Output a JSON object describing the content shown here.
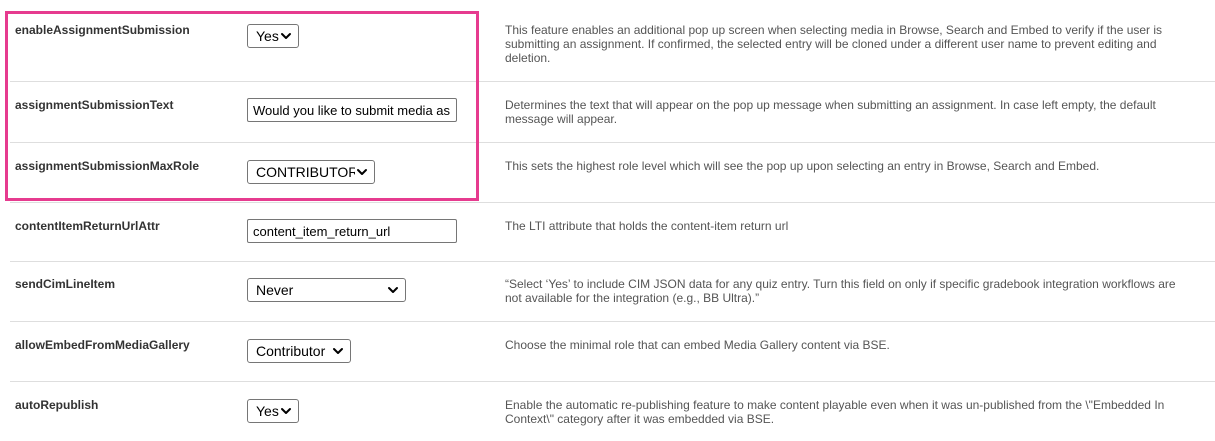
{
  "colors": {
    "highlight": "#e63b8f",
    "divider": "#dedede",
    "label_text": "#333333",
    "description_text": "#555555"
  },
  "settings": [
    {
      "key": "enableAssignmentSubmission",
      "control": "select",
      "value": "Yes",
      "description": "This feature enables an additional pop up screen when selecting media in Browse, Search and Embed to verify if the user is submitting an assignment. If confirmed, the selected entry will be cloned under a different user name to prevent editing and deletion."
    },
    {
      "key": "assignmentSubmissionText",
      "control": "text",
      "value": "Would you like to submit media as an assignment?",
      "description": "Determines the text that will appear on the pop up message when submitting an assignment. In case left empty, the default message will appear."
    },
    {
      "key": "assignmentSubmissionMaxRole",
      "control": "select",
      "value": "CONTRIBUTOR",
      "description": "This sets the highest role level which will see the pop up upon selecting an entry in Browse, Search and Embed."
    },
    {
      "key": "contentItemReturnUrlAttr",
      "control": "text",
      "value": "content_item_return_url",
      "description": "The LTI attribute that holds the content-item return url"
    },
    {
      "key": "sendCimLineItem",
      "control": "select",
      "value": "Never",
      "description": "“Select ‘Yes’ to include CIM JSON data for any quiz entry. Turn this field on only if specific gradebook integration workflows are not available for the integration (e.g., BB Ultra).”"
    },
    {
      "key": "allowEmbedFromMediaGallery",
      "control": "select",
      "value": "Contributor",
      "description": "Choose the minimal role that can embed Media Gallery content via BSE."
    },
    {
      "key": "autoRepublish",
      "control": "select",
      "value": "Yes",
      "description": "Enable the automatic re-publishing feature to make content playable even when it was un-published from the \\\"Embedded In Context\\\" category after it was embedded via BSE."
    }
  ]
}
